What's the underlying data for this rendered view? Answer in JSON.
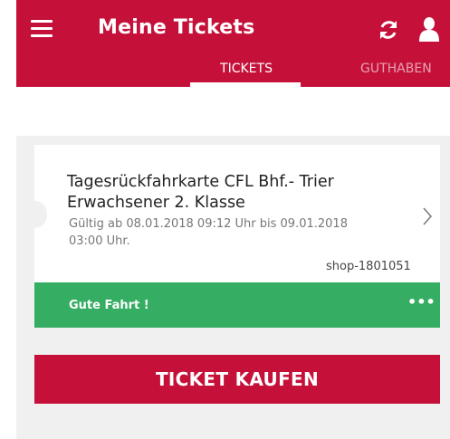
{
  "header": {
    "title": "Meine Tickets",
    "icons": [
      "menu-icon",
      "refresh-icon",
      "user-icon"
    ]
  },
  "tabs": [
    {
      "label": "TICKETS",
      "active": true
    },
    {
      "label": "GUTHABEN",
      "active": false
    }
  ],
  "ticket": {
    "title": "Tagesrückfahrkarte CFL Bhf.- Trier Erwachsener 2. Klasse",
    "validity": "Gültig ab 08.01.2018 09:12 Uhr bis 09.01.2018 03:00 Uhr.",
    "order_no": "shop-1801051",
    "status_message": "Gute Fahrt !",
    "more_label": "•••"
  },
  "buy_button": {
    "label": "TICKET KAUFEN"
  },
  "colors": {
    "brand": "#c5113a",
    "success": "#35ad62",
    "panel": "#f0f0f0"
  }
}
